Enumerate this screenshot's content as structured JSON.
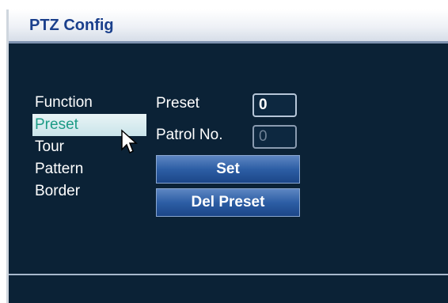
{
  "window": {
    "title": "PTZ Config"
  },
  "menu": {
    "heading": "Function",
    "items": [
      {
        "label": "Preset",
        "selected": true
      },
      {
        "label": "Tour",
        "selected": false
      },
      {
        "label": "Pattern",
        "selected": false
      },
      {
        "label": "Border",
        "selected": false
      }
    ]
  },
  "form": {
    "preset_label": "Preset",
    "preset_value": "0",
    "patrol_label": "Patrol No.",
    "patrol_value": "0",
    "set_button": "Set",
    "del_preset_button": "Del Preset"
  },
  "colors": {
    "background": "#0b2236",
    "title_text": "#1a3f8c",
    "selected_text": "#1d9b86",
    "button": "#2d5ea5"
  }
}
